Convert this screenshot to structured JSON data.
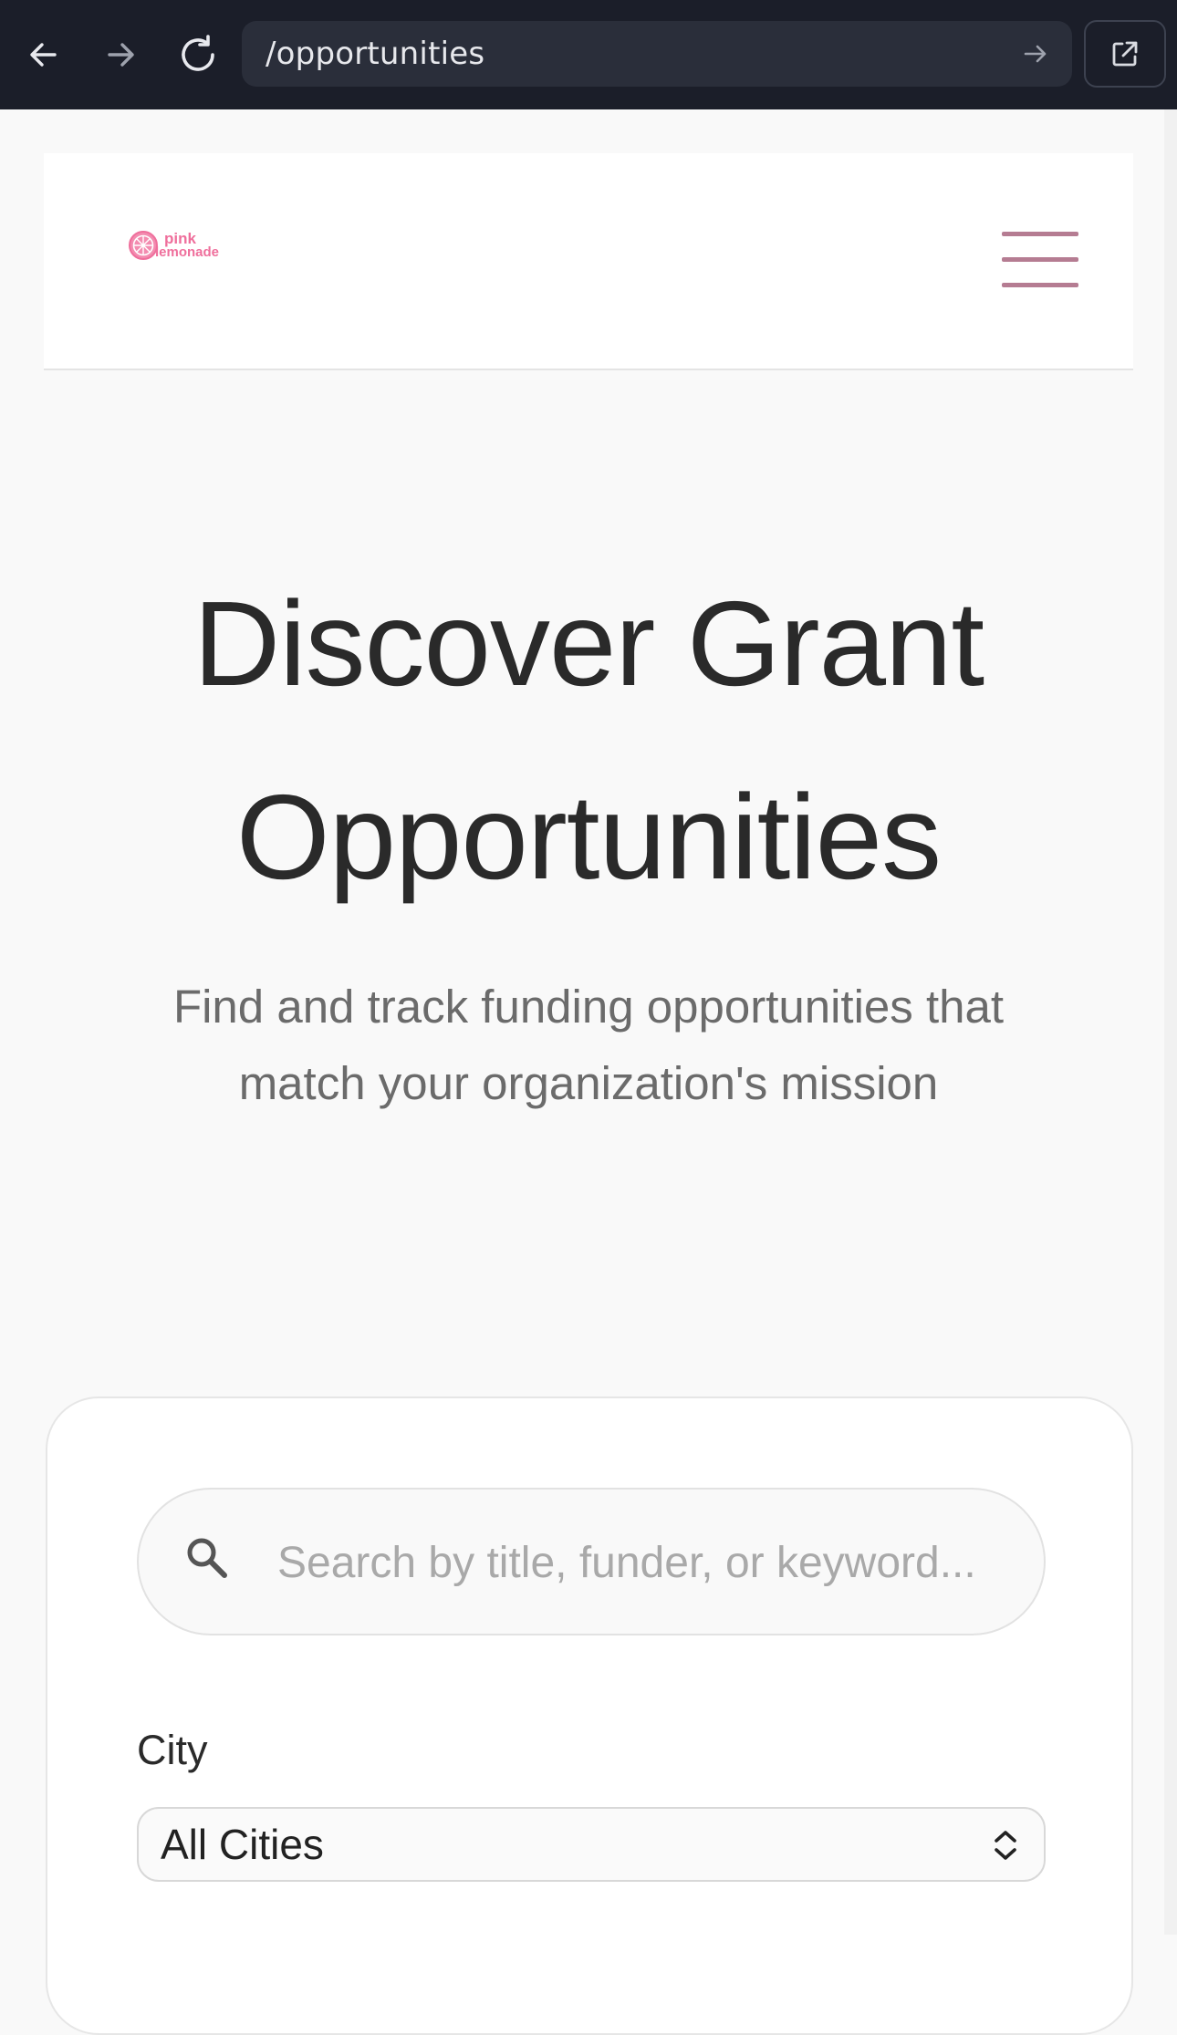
{
  "browser": {
    "url": "/opportunities",
    "back_icon": "arrow-left-icon",
    "forward_icon": "arrow-right-icon",
    "reload_icon": "reload-icon",
    "go_icon": "arrow-right-icon",
    "external_icon": "external-link-icon"
  },
  "header": {
    "logo_line1": "pink",
    "logo_line2": "lemonade",
    "menu_icon": "hamburger-menu-icon",
    "accent_color": "#ef6f9c",
    "menu_color": "#b57c92"
  },
  "hero": {
    "title_line1": "Discover Grant",
    "title_line2": "Opportunities",
    "subtitle": "Find and track funding opportunities that match your organization's mission"
  },
  "filters": {
    "search_placeholder": "Search by title, funder, or keyword...",
    "search_value": "",
    "city_label": "City",
    "city_selected": "All Cities"
  }
}
